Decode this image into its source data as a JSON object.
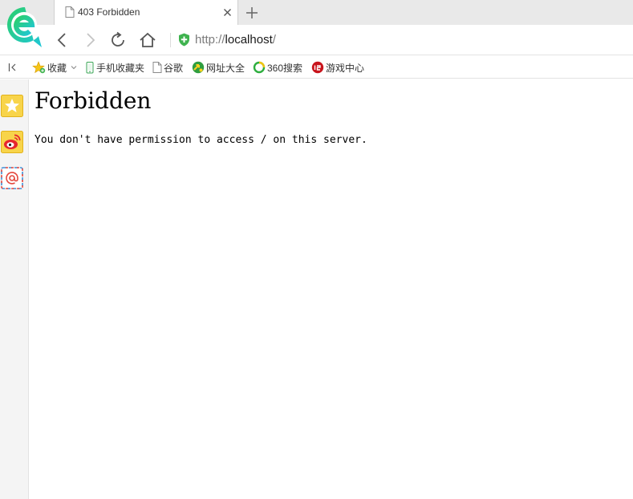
{
  "browser": {
    "tab": {
      "title": "403 Forbidden"
    },
    "address": {
      "scheme": "http://",
      "host": "localhost",
      "path": "/"
    }
  },
  "bookmarks": [
    {
      "label": "收藏",
      "icon": "star-add-icon"
    },
    {
      "label": "手机收藏夹",
      "icon": "phone-icon"
    },
    {
      "label": "谷歌",
      "icon": "page-icon"
    },
    {
      "label": "网址大全",
      "icon": "url-directory-icon"
    },
    {
      "label": "360搜索",
      "icon": "360-search-icon"
    },
    {
      "label": "游戏中心",
      "icon": "game-center-icon"
    }
  ],
  "sidebar": [
    "favorites-star-icon",
    "weibo-icon",
    "mail-at-icon"
  ],
  "page": {
    "heading": "Forbidden",
    "message": "You don't have permission to access / on this server."
  },
  "colors": {
    "logo_green": "#2ccf6b",
    "logo_cyan": "#1fc6d8",
    "security_green": "#3fb34f",
    "sidebar_bg": "#f4f4f4"
  }
}
